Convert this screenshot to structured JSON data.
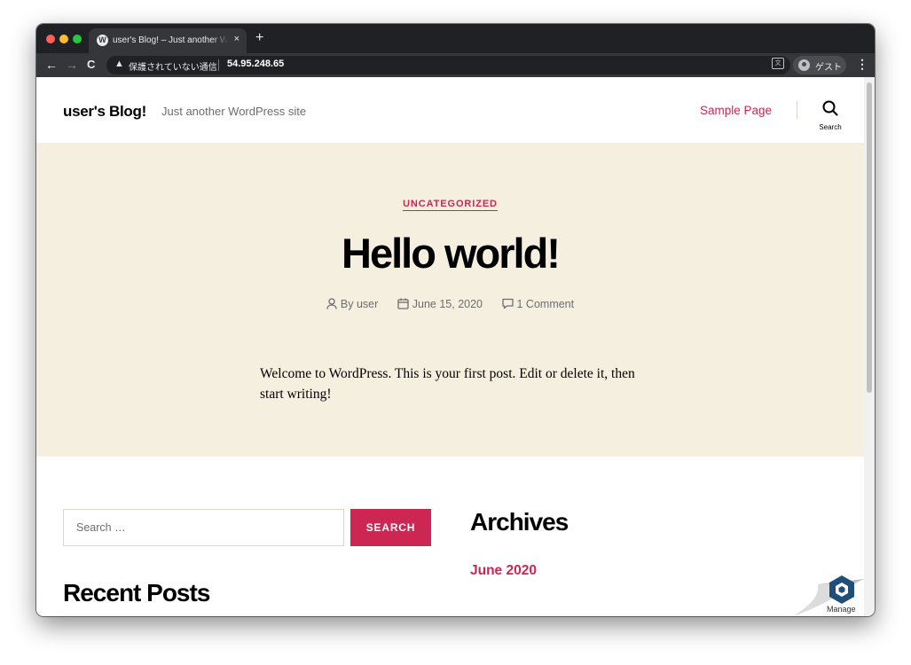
{
  "browser": {
    "tab_title": "user's Blog! – Just another WordPress site",
    "tab_favicon": "W",
    "tab_close": "×",
    "new_tab": "+",
    "security_label": "保護されていない通信",
    "url": "54.95.248.65",
    "profile_label": "ゲスト",
    "icons": [
      "back-arrow-icon",
      "forward-arrow-icon",
      "reload-icon",
      "warning-icon",
      "translate-icon",
      "profile-icon",
      "menu-dots-icon"
    ]
  },
  "site": {
    "title": "user's Blog!",
    "description": "Just another WordPress site",
    "nav_item": "Sample Page",
    "search_toggle_label": "Search"
  },
  "post": {
    "category": "UNCATEGORIZED",
    "title": "Hello world!",
    "author": "By user",
    "date": "June 15, 2020",
    "comments": "1 Comment",
    "body": "Welcome to WordPress. This is your first post. Edit or delete it, then start writing!"
  },
  "widgets": {
    "search_placeholder": "Search …",
    "search_button": "SEARCH",
    "recent_posts_heading": "Recent Posts",
    "archives_heading": "Archives",
    "archive_link": "June 2020"
  },
  "manage": {
    "label": "Manage"
  },
  "colors": {
    "accent": "#cd2653",
    "hero_background": "#f5efe0",
    "browser_chrome": "#202124"
  }
}
